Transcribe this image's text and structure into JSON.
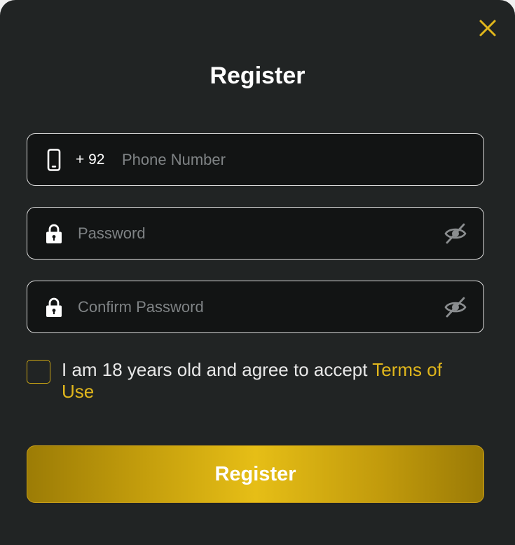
{
  "dialog": {
    "title": "Register",
    "close_icon": "close-icon"
  },
  "phone": {
    "icon": "smartphone-icon",
    "country_code": "+ 92",
    "value": "",
    "placeholder": "Phone Number"
  },
  "password": {
    "icon": "lock-icon",
    "value": "",
    "placeholder": "Password",
    "toggle_icon": "eye-slash-icon"
  },
  "confirm_password": {
    "icon": "lock-icon",
    "value": "",
    "placeholder": "Confirm Password",
    "toggle_icon": "eye-slash-icon"
  },
  "agreement": {
    "checked": false,
    "text": "I am 18 years old and agree to accept ",
    "link_text": "Terms of Use"
  },
  "submit": {
    "label": "Register"
  },
  "colors": {
    "background": "#212424",
    "field_background": "#121414",
    "accent": "#e0b61c",
    "text": "#ffffff",
    "placeholder": "#7f8385"
  }
}
